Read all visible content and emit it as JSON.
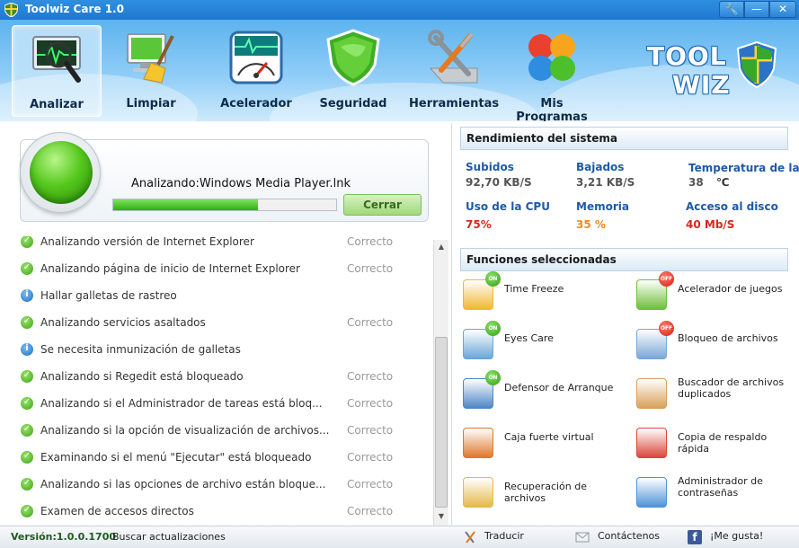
{
  "window": {
    "title": "Toolwiz Care 1.0",
    "settings_glyph": "🔧",
    "minimize_glyph": "—",
    "close_glyph": "✕"
  },
  "nav": {
    "items": [
      {
        "label": "Analizar",
        "icon": "monitor-heartbeat-icon",
        "active": true
      },
      {
        "label": "Limpiar",
        "icon": "computer-broom-icon"
      },
      {
        "label": "Acelerador",
        "icon": "speedometer-icon"
      },
      {
        "label": "Seguridad",
        "icon": "shield-icon"
      },
      {
        "label": "Herramientas",
        "icon": "tools-icon"
      },
      {
        "label": "Mis Programas",
        "icon": "programs-icon"
      }
    ]
  },
  "brand": {
    "line1": "TOOL",
    "line2": "WIZ"
  },
  "scan": {
    "status_text": "Analizando:Windows Media Player.lnk",
    "progress": 0.65,
    "close_label": "Cerrar"
  },
  "results": [
    {
      "text": "Analizando versión de Internet Explorer",
      "status": "Correcto",
      "type": "ok"
    },
    {
      "text": "Analizando página de inicio de Internet Explorer",
      "status": "Correcto",
      "type": "ok"
    },
    {
      "text": "Hallar galletas de rastreo",
      "status": "",
      "type": "info"
    },
    {
      "text": "Analizando servicios asaltados",
      "status": "Correcto",
      "type": "ok"
    },
    {
      "text": "Se necesita inmunización de galletas",
      "status": "",
      "type": "info"
    },
    {
      "text": "Analizando si Regedit está bloqueado",
      "status": "Correcto",
      "type": "ok"
    },
    {
      "text": "Analizando si el Administrador de tareas está bloq...",
      "status": "Correcto",
      "type": "ok"
    },
    {
      "text": "Analizando si la opción de visualización de archivos...",
      "status": "Correcto",
      "type": "ok"
    },
    {
      "text": "Examinando si el menú \"Ejecutar\" está bloqueado",
      "status": "Correcto",
      "type": "ok"
    },
    {
      "text": "Analizando si las opciones de archivo están bloque...",
      "status": "Correcto",
      "type": "ok"
    },
    {
      "text": "Examen de accesos directos",
      "status": "Correcto",
      "type": "ok"
    }
  ],
  "glyphs": {
    "ok": "✓",
    "info": "i",
    "up": "▲",
    "down": "▼"
  },
  "performance": {
    "title": "Rendimiento del sistema",
    "upload": {
      "label": "Subidos",
      "value": "92,70 KB/S",
      "color": "#555555"
    },
    "download": {
      "label": "Bajados",
      "value": "3,21 KB/S",
      "color": "#555555"
    },
    "temperature": {
      "label": "Temperatura de la",
      "value": "38",
      "unit": "℃",
      "color": "#555555"
    },
    "cpu": {
      "label": "Uso de la CPU",
      "value": "75%",
      "color": "#d42a1a"
    },
    "memory": {
      "label": "Memoria",
      "value": "35 %",
      "color": "#e58a2c"
    },
    "disk": {
      "label": "Acceso al disco",
      "value": "40 Mb/S",
      "color": "#d42a1a"
    }
  },
  "features": {
    "title": "Funciones seleccionadas",
    "items": [
      {
        "label": "Time Freeze",
        "badge": "ON",
        "icon": "clock-icon",
        "color": "#f2b733"
      },
      {
        "label": "Acelerador de juegos",
        "badge": "OFF",
        "icon": "gamepad-icon",
        "color": "#6fbf3a"
      },
      {
        "label": "Eyes Care",
        "badge": "ON",
        "icon": "eye-icon",
        "color": "#6aa6d8"
      },
      {
        "label": "Bloqueo de archivos",
        "badge": "OFF",
        "icon": "file-lock-icon",
        "color": "#7aa7d6"
      },
      {
        "label": "Defensor de Arranque",
        "badge": "ON",
        "icon": "boot-defender-icon",
        "color": "#4f86c6"
      },
      {
        "label": "Buscador de archivos duplicados",
        "badge": "",
        "icon": "duplicate-files-icon",
        "color": "#d9a05a"
      },
      {
        "label": "Caja fuerte virtual",
        "badge": "",
        "icon": "vault-icon",
        "color": "#e0782c"
      },
      {
        "label": "Copia de respaldo rápida",
        "badge": "",
        "icon": "backup-icon",
        "color": "#d9473a"
      },
      {
        "label": "Recuperación de archivos",
        "badge": "",
        "icon": "folder-recovery-icon",
        "color": "#e7b84a"
      },
      {
        "label": "Administrador de contraseñas",
        "badge": "",
        "icon": "key-icon",
        "color": "#4f93d9"
      }
    ]
  },
  "status": {
    "version": "Versión:1.0.0.1700",
    "update": "Buscar actualizaciones",
    "translate": "Traducir",
    "contact": "Contáctenos",
    "like": "¡Me gusta!",
    "facebook_glyph": "f"
  }
}
